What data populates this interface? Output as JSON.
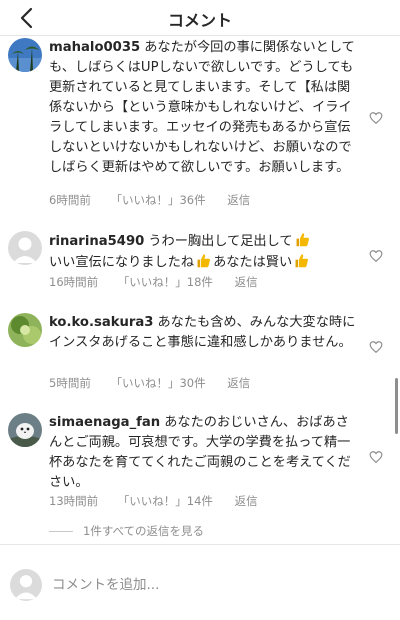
{
  "header": {
    "title": "コメント",
    "back_icon": "chevron-left-icon"
  },
  "comments": [
    {
      "username": "mahalo0035",
      "text": "あなたが今回の事に関係ないとしても、しばらくはUPしないで欲しいです。どうしても更新されていると見てしまいます。そして【私は関係ないから【という意味かもしれないけど、イライラしてしまいます。エッセイの発売もあるから宣伝しないといけないかもしれないけど、お願いなのでしばらく更新はやめて欲しいです。お願いします。",
      "time": "6時間前",
      "likes": "「いいね！」36件",
      "reply": "返信"
    },
    {
      "username": "rinarina5490",
      "text_parts": [
        "うわー胸出して足出して",
        "いい宣伝になりましたね",
        "あなたは賢い"
      ],
      "time": "16時間前",
      "likes": "「いいね！」18件",
      "reply": "返信"
    },
    {
      "username": "ko.ko.sakura3",
      "text": "あなたも含め、みんな大変な時にインスタあげること事態に違和感しかありません。",
      "time": "5時間前",
      "likes": "「いいね！」30件",
      "reply": "返信"
    },
    {
      "username": "simaenaga_fan",
      "text": "あなたのおじいさん、おばあさんとご両親。可哀想です。大学の学費を払って精一杯あなたを育ててくれたご両親のことを考えてください。",
      "time": "13時間前",
      "likes": "「いいね！」14件",
      "reply": "返信"
    }
  ],
  "view_replies": "1件すべての返信を見る",
  "composer": {
    "placeholder": "コメントを追加..."
  },
  "colors": {
    "text": "#262626",
    "secondary": "#8e8e8e",
    "divider": "#e6e6e6",
    "emoji": "#f5b800"
  }
}
